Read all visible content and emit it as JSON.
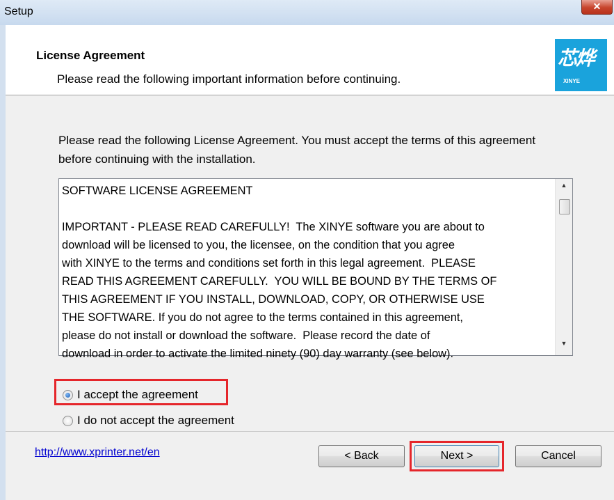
{
  "window": {
    "title": "Setup",
    "close_label": "✕"
  },
  "header": {
    "title": "License Agreement",
    "subtitle": "Please read the following important information before continuing.",
    "logo_cn": "芯烨",
    "logo_en": "XINYE"
  },
  "intro": "Please read the following License Agreement. You must accept the terms of this agreement before continuing with the installation.",
  "license": {
    "heading": "SOFTWARE LICENSE AGREEMENT",
    "body": "IMPORTANT - PLEASE READ CAREFULLY!  The XINYE software you are about to\ndownload will be licensed to you, the licensee, on the condition that you agree\nwith XINYE to the terms and conditions set forth in this legal agreement.  PLEASE\nREAD THIS AGREEMENT CAREFULLY.  YOU WILL BE BOUND BY THE TERMS OF\nTHIS AGREEMENT IF YOU INSTALL, DOWNLOAD, COPY, OR OTHERWISE USE\nTHE SOFTWARE. If you do not agree to the terms contained in this agreement,\nplease do not install or download the software.  Please record the date of\ndownload in order to activate the limited ninety (90) day warranty (see below)."
  },
  "options": {
    "accept": "I accept the agreement",
    "decline": "I do not accept the agreement",
    "selected": "accept"
  },
  "footer": {
    "link": "http://www.xprinter.net/en",
    "back": "< Back",
    "next": "Next >",
    "cancel": "Cancel"
  },
  "colors": {
    "highlight": "#e5262b",
    "logo_bg": "#1aa3dc",
    "link": "#0000d0"
  }
}
